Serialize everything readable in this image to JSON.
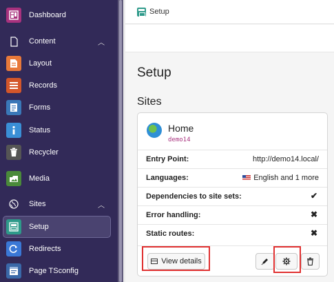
{
  "sidebar": {
    "items": [
      {
        "label": "Dashboard",
        "icon": "dashboard-icon",
        "color": "#a8327e"
      },
      {
        "label": "Content",
        "icon": "page-icon",
        "color": "",
        "group": true
      },
      {
        "label": "Layout",
        "icon": "layout-icon",
        "color": "#e8793a"
      },
      {
        "label": "Records",
        "icon": "records-icon",
        "color": "#d4562a"
      },
      {
        "label": "Forms",
        "icon": "forms-icon",
        "color": "#3a78b8"
      },
      {
        "label": "Status",
        "icon": "info-icon",
        "color": "#3a8fd6"
      },
      {
        "label": "Recycler",
        "icon": "trash-icon",
        "color": "#555555"
      },
      {
        "label": "Media",
        "icon": "media-icon",
        "color": "#4a8a3a"
      },
      {
        "label": "Sites",
        "icon": "globe-icon",
        "color": "",
        "group": true
      },
      {
        "label": "Setup",
        "icon": "setup-icon",
        "color": "#2e9a8a"
      },
      {
        "label": "Redirects",
        "icon": "redirect-icon",
        "color": "#3a78d6"
      },
      {
        "label": "Page TSconfig",
        "icon": "tsconfig-icon",
        "color": "#3a68a8"
      }
    ]
  },
  "topbar": {
    "title": "Setup"
  },
  "main": {
    "heading": "Setup",
    "section": "Sites",
    "site": {
      "title": "Home",
      "identifier": "demo14",
      "rows": [
        {
          "label": "Entry Point:",
          "value": "http://demo14.local/"
        },
        {
          "label": "Languages:",
          "value": "English and 1 more"
        },
        {
          "label": "Dependencies to site sets:",
          "mark": "✔"
        },
        {
          "label": "Error handling:",
          "mark": "✖"
        },
        {
          "label": "Static routes:",
          "mark": "✖"
        }
      ],
      "buttons": {
        "view_details": "View details"
      }
    }
  }
}
